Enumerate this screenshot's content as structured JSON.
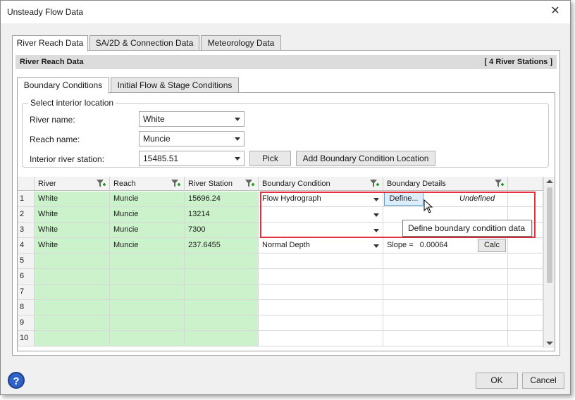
{
  "window": {
    "title": "Unsteady Flow Data"
  },
  "outer_tabs": [
    {
      "label": "River Reach Data"
    },
    {
      "label": "SA/2D & Connection Data"
    },
    {
      "label": "Meteorology Data"
    }
  ],
  "header": {
    "title": "River Reach Data",
    "stations": "[ 4 River Stations ]"
  },
  "inner_tabs": [
    {
      "label": "Boundary Conditions"
    },
    {
      "label": "Initial Flow & Stage Conditions"
    }
  ],
  "location": {
    "group_title": "Select interior location",
    "river_label": "River name:",
    "river_value": "White",
    "reach_label": "Reach name:",
    "reach_value": "Muncie",
    "station_label": "Interior river station:",
    "station_value": "15485.51",
    "pick_label": "Pick",
    "add_label": "Add Boundary Condition Location"
  },
  "grid": {
    "columns": [
      "River",
      "Reach",
      "River Station",
      "Boundary Condition",
      "Boundary Details"
    ],
    "rows": [
      {
        "num": "1",
        "river": "White",
        "reach": "Muncie",
        "station": "15696.24",
        "bc": "Flow Hydrograph",
        "details": "Undefined",
        "button": "Define..."
      },
      {
        "num": "2",
        "river": "White",
        "reach": "Muncie",
        "station": "13214",
        "bc": "",
        "details": "",
        "button": ""
      },
      {
        "num": "3",
        "river": "White",
        "reach": "Muncie",
        "station": "7300",
        "bc": "",
        "details": "",
        "button": ""
      },
      {
        "num": "4",
        "river": "White",
        "reach": "Muncie",
        "station": "237.6455",
        "bc": "Normal Depth",
        "details": "Slope =   0.00064",
        "button": "Calc"
      },
      {
        "num": "5",
        "river": "",
        "reach": "",
        "station": "",
        "bc": "",
        "details": "",
        "button": ""
      },
      {
        "num": "6",
        "river": "",
        "reach": "",
        "station": "",
        "bc": "",
        "details": "",
        "button": ""
      },
      {
        "num": "7",
        "river": "",
        "reach": "",
        "station": "",
        "bc": "",
        "details": "",
        "button": ""
      },
      {
        "num": "8",
        "river": "",
        "reach": "",
        "station": "",
        "bc": "",
        "details": "",
        "button": ""
      },
      {
        "num": "9",
        "river": "",
        "reach": "",
        "station": "",
        "bc": "",
        "details": "",
        "button": ""
      },
      {
        "num": "10",
        "river": "",
        "reach": "",
        "station": "",
        "bc": "",
        "details": "",
        "button": ""
      }
    ]
  },
  "tooltip": "Define boundary condition data",
  "footer": {
    "ok": "OK",
    "cancel": "Cancel",
    "help": "?"
  },
  "colors": {
    "row_green": "#ccf2cc",
    "highlight": "#e0323c",
    "define_blue": "#dceefb"
  },
  "icons": {
    "close": "close-icon",
    "filter": "filter-add-icon",
    "help": "help-icon",
    "cursor": "mouse-pointer-icon"
  }
}
